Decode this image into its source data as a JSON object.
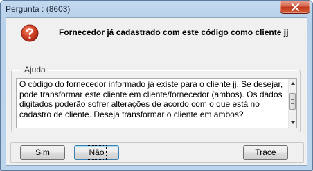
{
  "window": {
    "title": "Pergunta : (8603)"
  },
  "message": {
    "text": "Fornecedor já cadastrado com este código como cliente jj"
  },
  "help": {
    "legend": "Ajuda",
    "text": "O código do fornecedor informado já existe para o cliente jj. Se desejar, pode transformar este cliente em cliente/fornecedor (ambos). Os dados digitados poderão sofrer alterações de acordo com o que está  no cadastro de cliente. Deseja transformar o cliente em ambos?"
  },
  "buttons": {
    "sim": "Sim",
    "nao": "Não",
    "trace": "Trace"
  },
  "icons": {
    "question": "question-icon",
    "close": "close-icon",
    "scroll_up": "chevron-up-icon",
    "scroll_down": "chevron-down-icon"
  },
  "colors": {
    "title_bar": "#b9d1ea",
    "close_button": "#c1391d",
    "question_icon": "#c8341c"
  }
}
